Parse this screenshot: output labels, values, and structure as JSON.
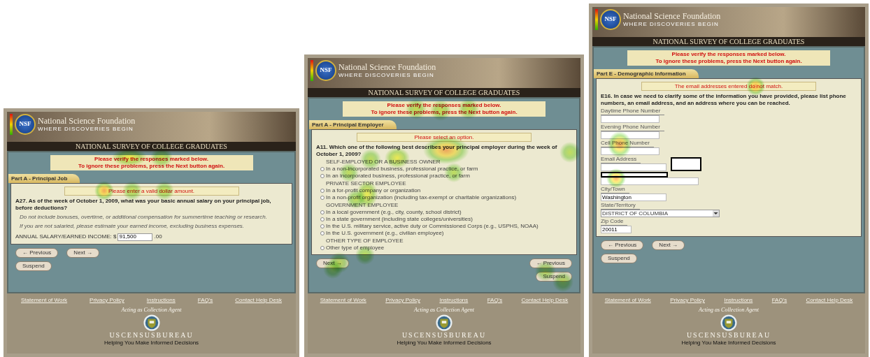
{
  "panels": [
    {
      "header": {
        "logo": "NSF",
        "org": "National Science Foundation",
        "tagline": "WHERE DISCOVERIES BEGIN",
        "survey_title": "NATIONAL SURVEY OF COLLEGE GRADUATES"
      },
      "alert": [
        "Please verify the responses marked below.",
        "To ignore these problems, press the Next button again."
      ],
      "section_tab": "Part A - Principal Job",
      "error": "Please enter a valid dollar amount.",
      "question": "A27. As of the week of October 1, 2009, what was your basic annual salary on your principal job, before deductions?",
      "content": [
        {
          "kind": "note",
          "text": "Do not include bonuses, overtime, or additional compensation for summertime teaching or research."
        },
        {
          "kind": "note",
          "text": "If you are not salaried, please estimate your earned income, excluding business expenses."
        },
        {
          "kind": "income",
          "label": "ANNUAL SALARY/EARNED INCOME: $",
          "value": "91,500",
          "suffix": ".00"
        }
      ],
      "button_rows": [
        {
          "left": [
            "← Previous",
            "Next →"
          ],
          "right": []
        },
        {
          "left": [
            "Suspend"
          ],
          "right": []
        }
      ],
      "footer": {
        "links": [
          "Statement of Work",
          "Privacy Policy",
          "Instructions",
          "FAQ's",
          "Contact Help Desk"
        ],
        "agent": "Acting as Collection Agent",
        "agency": "USCENSUSBUREAU",
        "motto": "Helping You Make Informed Decisions"
      }
    },
    {
      "header": {
        "logo": "NSF",
        "org": "National Science Foundation",
        "tagline": "WHERE DISCOVERIES BEGIN",
        "survey_title": "NATIONAL SURVEY OF COLLEGE GRADUATES"
      },
      "alert": [
        "Please verify the responses marked below.",
        "To ignore these problems, press the Next button again."
      ],
      "section_tab": "Part A - Principal Employer",
      "error": "Please select an option.",
      "question": "A11. Which one of the following best describes your principal employer during the week of October 1, 2009?",
      "content": [
        {
          "kind": "heading",
          "text": "SELF-EMPLOYED OR A BUSINESS OWNER"
        },
        {
          "kind": "radio",
          "text": "In a non-incorporated business, professional practice, or farm",
          "selected": false
        },
        {
          "kind": "radio",
          "text": "In an incorporated business, professional practice, or farm",
          "selected": false
        },
        {
          "kind": "heading",
          "text": "PRIVATE SECTOR EMPLOYEE"
        },
        {
          "kind": "radio",
          "text": "In a for-profit company or organization",
          "selected": false
        },
        {
          "kind": "radio",
          "text": "In a non-profit organization (including tax-exempt or charitable organizations)",
          "selected": false
        },
        {
          "kind": "heading",
          "text": "GOVERNMENT EMPLOYEE"
        },
        {
          "kind": "radio",
          "text": "In a local government (e.g., city, county, school district)",
          "selected": false
        },
        {
          "kind": "radio",
          "text": "In a state government (including state colleges/universities)",
          "selected": false
        },
        {
          "kind": "radio",
          "text": "In the U.S. military service, active duty or Commissioned Corps (e.g., USPHS, NOAA)",
          "selected": false
        },
        {
          "kind": "radio",
          "text": "In the U.S. government (e.g., civilian employee)",
          "selected": false
        },
        {
          "kind": "heading",
          "text": "OTHER TYPE OF EMPLOYEE"
        },
        {
          "kind": "radio",
          "text": "Other type of employee",
          "selected": false
        }
      ],
      "button_rows": [
        {
          "left": [
            "Next →"
          ],
          "right": [
            "← Previous"
          ]
        },
        {
          "left": [],
          "right": [
            "Suspend"
          ]
        }
      ],
      "footer": {
        "links": [
          "Statement of Work",
          "Privacy Policy",
          "Instructions",
          "FAQ's",
          "Contact Help Desk"
        ],
        "agent": "Acting as Collection Agent",
        "agency": "USCENSUSBUREAU",
        "motto": "Helping You Make Informed Decisions"
      }
    },
    {
      "header": {
        "logo": "NSF",
        "org": "National Science Foundation",
        "tagline": "WHERE DISCOVERIES BEGIN",
        "survey_title": "NATIONAL SURVEY OF COLLEGE GRADUATES"
      },
      "alert": [
        "Please verify the responses marked below.",
        "To ignore these problems, press the Next button again."
      ],
      "section_tab": "Part E - Demographic Information",
      "error": "The email addresses entered do not match.",
      "question": "E16. In case we need to clarify some of the information you have provided, please list phone numbers, an email address, and an address where you can be reached.",
      "content": [
        {
          "kind": "field",
          "label": "Daytime Phone Number"
        },
        {
          "kind": "field",
          "label": "Evening Phone Number"
        },
        {
          "kind": "field",
          "label": "Cell Phone Number"
        },
        {
          "kind": "field",
          "label": "Email Address"
        },
        {
          "kind": "field"
        },
        {
          "kind": "field",
          "label": "City/Town",
          "value": "Washington"
        },
        {
          "kind": "select",
          "label": "State/Territory",
          "value": "DISTRICT OF COLUMBIA"
        },
        {
          "kind": "field",
          "label": "Zip Code",
          "value": "20011"
        }
      ],
      "button_rows": [
        {
          "left": [
            "← Previous",
            "Next →"
          ],
          "right": []
        },
        {
          "left": [
            "Suspend"
          ],
          "right": []
        }
      ],
      "footer": {
        "links": [
          "Statement of Work",
          "Privacy Policy",
          "Instructions",
          "FAQ's",
          "Contact Help Desk"
        ],
        "agent": "Acting as Collection Agent",
        "agency": "USCENSUSBUREAU",
        "motto": "Helping You Make Informed Decisions"
      }
    }
  ]
}
